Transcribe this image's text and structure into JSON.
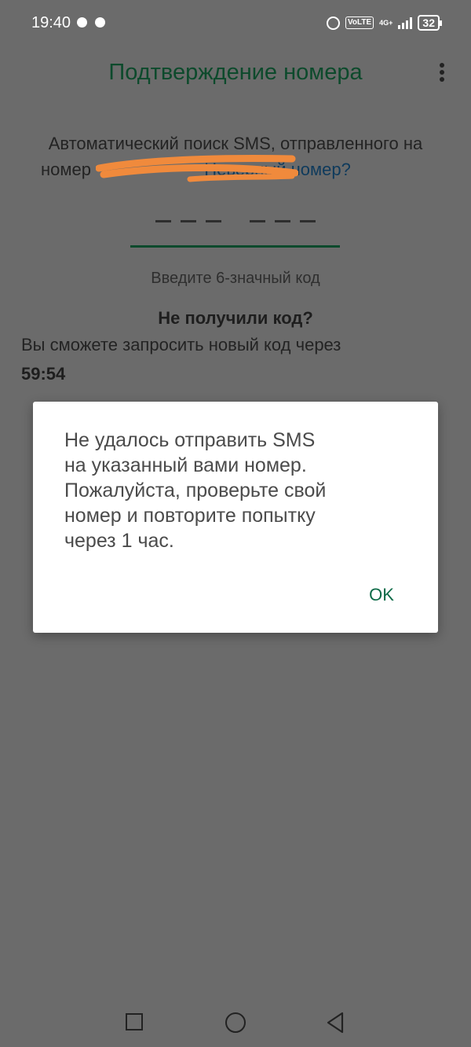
{
  "status_bar": {
    "time": "19:40",
    "volte": "VoLTE",
    "network": "4G+",
    "battery": "32"
  },
  "header": {
    "title": "Подтверждение номера",
    "menu_icon": "more-vert-icon"
  },
  "info": {
    "line1": "Автоматический поиск SMS, отправленного на",
    "line2_prefix": "номер",
    "wrong_number_link": "Неверный номер?"
  },
  "code_input": {
    "hint": "Введите 6-значный код"
  },
  "resend": {
    "title": "Не получили код?",
    "text": "Вы сможете запросить новый код через",
    "timer": "59:54"
  },
  "dialog": {
    "message_lines": [
      "Не удалось отправить SMS",
      "на указанный вами номер.",
      "Пожалуйста, проверьте свой",
      "номер и повторите попытку",
      "через 1 час."
    ],
    "ok_label": "OK"
  },
  "nav_bar": {
    "icons": [
      "recent-apps-icon",
      "home-icon",
      "back-icon"
    ]
  },
  "colors": {
    "title": "#0d4a2c",
    "dialog_button": "#0d6b48",
    "link": "#0e3a5c",
    "redaction": "#f08a3c",
    "scrim_background": "#6b6b6b"
  }
}
